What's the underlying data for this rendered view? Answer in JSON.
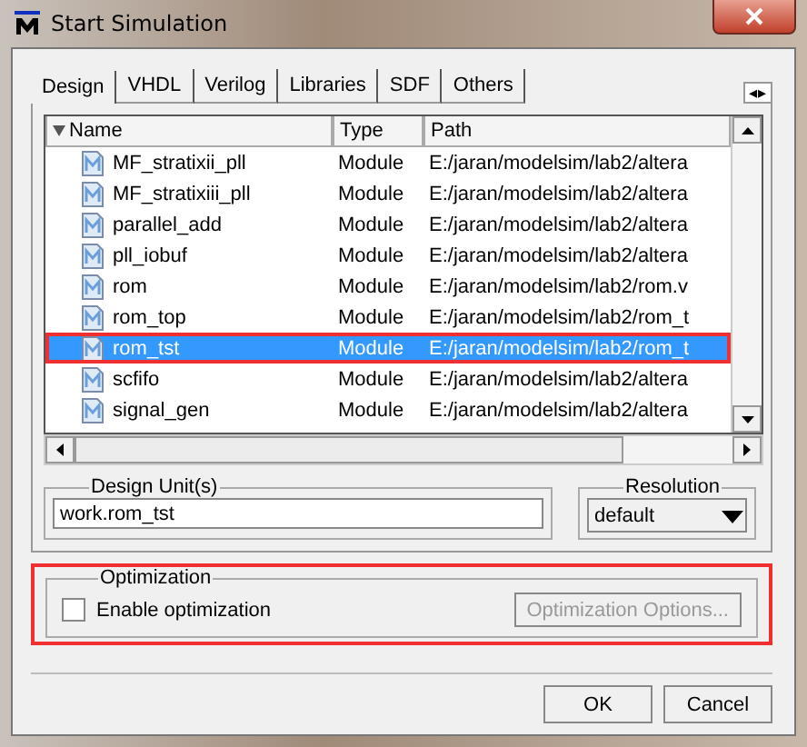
{
  "window": {
    "title": "Start Simulation"
  },
  "tab_scroll": "◂▸",
  "tabs": [
    {
      "label": "Design",
      "selected": true
    },
    {
      "label": "VHDL",
      "selected": false
    },
    {
      "label": "Verilog",
      "selected": false
    },
    {
      "label": "Libraries",
      "selected": false
    },
    {
      "label": "SDF",
      "selected": false
    },
    {
      "label": "Others",
      "selected": false
    }
  ],
  "table": {
    "columns": [
      "Name",
      "Type",
      "Path"
    ],
    "rows": [
      {
        "name": "MF_stratixii_pll",
        "type": "Module",
        "path": "E:/jaran/modelsim/lab2/altera",
        "selected": false,
        "highlighted": false
      },
      {
        "name": "MF_stratixiii_pll",
        "type": "Module",
        "path": "E:/jaran/modelsim/lab2/altera",
        "selected": false,
        "highlighted": false
      },
      {
        "name": "parallel_add",
        "type": "Module",
        "path": "E:/jaran/modelsim/lab2/altera",
        "selected": false,
        "highlighted": false
      },
      {
        "name": "pll_iobuf",
        "type": "Module",
        "path": "E:/jaran/modelsim/lab2/altera",
        "selected": false,
        "highlighted": false
      },
      {
        "name": "rom",
        "type": "Module",
        "path": "E:/jaran/modelsim/lab2/rom.v",
        "selected": false,
        "highlighted": false
      },
      {
        "name": "rom_top",
        "type": "Module",
        "path": "E:/jaran/modelsim/lab2/rom_t",
        "selected": false,
        "highlighted": false
      },
      {
        "name": "rom_tst",
        "type": "Module",
        "path": "E:/jaran/modelsim/lab2/rom_t",
        "selected": true,
        "highlighted": true
      },
      {
        "name": "scfifo",
        "type": "Module",
        "path": "E:/jaran/modelsim/lab2/altera",
        "selected": false,
        "highlighted": false
      },
      {
        "name": "signal_gen",
        "type": "Module",
        "path": "E:/jaran/modelsim/lab2/altera",
        "selected": false,
        "highlighted": false
      }
    ]
  },
  "design_unit": {
    "label": "Design Unit(s)",
    "value": "work.rom_tst"
  },
  "resolution": {
    "label": "Resolution",
    "value": "default"
  },
  "optimization": {
    "label": "Optimization",
    "highlighted": true,
    "enable": {
      "label": "Enable optimization",
      "checked": false
    },
    "options_button": {
      "label": "Optimization Options...",
      "disabled": true
    }
  },
  "buttons": [
    "OK",
    "Cancel"
  ]
}
